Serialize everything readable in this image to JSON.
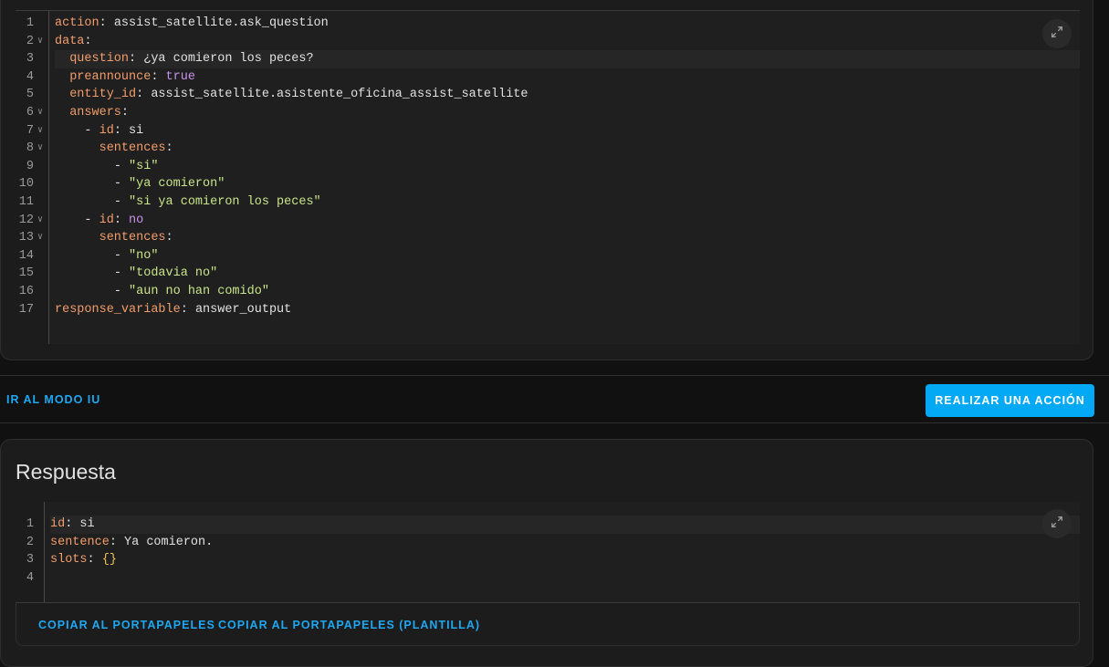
{
  "yaml_editor": {
    "lines": [
      {
        "n": "1",
        "fold": false,
        "indent": 0,
        "parts": [
          [
            "k",
            "action"
          ],
          [
            "p",
            ": "
          ],
          [
            "v",
            "assist_satellite.ask_question"
          ]
        ]
      },
      {
        "n": "2",
        "fold": true,
        "indent": 0,
        "parts": [
          [
            "k",
            "data"
          ],
          [
            "p",
            ":"
          ]
        ]
      },
      {
        "n": "3",
        "fold": false,
        "indent": 2,
        "active": true,
        "parts": [
          [
            "k",
            "question"
          ],
          [
            "p",
            ": "
          ],
          [
            "v",
            "¿ya comieron los peces?"
          ]
        ]
      },
      {
        "n": "4",
        "fold": false,
        "indent": 2,
        "parts": [
          [
            "k",
            "preannounce"
          ],
          [
            "p",
            ": "
          ],
          [
            "b",
            "true"
          ]
        ]
      },
      {
        "n": "5",
        "fold": false,
        "indent": 2,
        "parts": [
          [
            "k",
            "entity_id"
          ],
          [
            "p",
            ": "
          ],
          [
            "v",
            "assist_satellite.asistente_oficina_assist_satellite"
          ]
        ]
      },
      {
        "n": "6",
        "fold": true,
        "indent": 2,
        "parts": [
          [
            "k",
            "answers"
          ],
          [
            "p",
            ":"
          ]
        ]
      },
      {
        "n": "7",
        "fold": true,
        "indent": 4,
        "parts": [
          [
            "p",
            "- "
          ],
          [
            "k",
            "id"
          ],
          [
            "p",
            ": "
          ],
          [
            "v",
            "si"
          ]
        ]
      },
      {
        "n": "8",
        "fold": true,
        "indent": 6,
        "parts": [
          [
            "k",
            "sentences"
          ],
          [
            "p",
            ":"
          ]
        ]
      },
      {
        "n": "9",
        "fold": false,
        "indent": 8,
        "parts": [
          [
            "p",
            "- "
          ],
          [
            "s",
            "\"si\""
          ]
        ]
      },
      {
        "n": "10",
        "fold": false,
        "indent": 8,
        "parts": [
          [
            "p",
            "- "
          ],
          [
            "s",
            "\"ya comieron\""
          ]
        ]
      },
      {
        "n": "11",
        "fold": false,
        "indent": 8,
        "parts": [
          [
            "p",
            "- "
          ],
          [
            "s",
            "\"si ya comieron los peces\""
          ]
        ]
      },
      {
        "n": "12",
        "fold": true,
        "indent": 4,
        "parts": [
          [
            "p",
            "- "
          ],
          [
            "k",
            "id"
          ],
          [
            "p",
            ": "
          ],
          [
            "b",
            "no"
          ]
        ]
      },
      {
        "n": "13",
        "fold": true,
        "indent": 6,
        "parts": [
          [
            "k",
            "sentences"
          ],
          [
            "p",
            ":"
          ]
        ]
      },
      {
        "n": "14",
        "fold": false,
        "indent": 8,
        "parts": [
          [
            "p",
            "- "
          ],
          [
            "s",
            "\"no\""
          ]
        ]
      },
      {
        "n": "15",
        "fold": false,
        "indent": 8,
        "parts": [
          [
            "p",
            "- "
          ],
          [
            "s",
            "\"todavia no\""
          ]
        ]
      },
      {
        "n": "16",
        "fold": false,
        "indent": 8,
        "parts": [
          [
            "p",
            "- "
          ],
          [
            "s",
            "\"aun no han comido\""
          ]
        ]
      },
      {
        "n": "17",
        "fold": false,
        "indent": 0,
        "parts": [
          [
            "k",
            "response_variable"
          ],
          [
            "p",
            ": "
          ],
          [
            "v",
            "answer_output"
          ]
        ]
      }
    ]
  },
  "actions_bar": {
    "ui_mode_label": "IR AL MODO IU",
    "perform_action_label": "REALIZAR UNA ACCIÓN"
  },
  "response": {
    "title": "Respuesta",
    "lines": [
      {
        "n": "1",
        "fold": false,
        "indent": 0,
        "active": true,
        "parts": [
          [
            "k",
            "id"
          ],
          [
            "p",
            ": "
          ],
          [
            "v",
            "si"
          ]
        ]
      },
      {
        "n": "2",
        "fold": false,
        "indent": 0,
        "parts": [
          [
            "k",
            "sentence"
          ],
          [
            "p",
            ": "
          ],
          [
            "v",
            "Ya comieron."
          ]
        ]
      },
      {
        "n": "3",
        "fold": false,
        "indent": 0,
        "parts": [
          [
            "k",
            "slots"
          ],
          [
            "p",
            ": "
          ],
          [
            "br",
            "{}"
          ]
        ]
      },
      {
        "n": "4",
        "fold": false,
        "indent": 0,
        "parts": []
      }
    ],
    "copy_label": "COPIAR AL PORTAPAPELES",
    "copy_template_label": "COPIAR AL PORTAPAPELES (PLANTILLA)"
  },
  "icons": {
    "expand": "fullscreen-icon",
    "fold": "chevron-down-icon"
  },
  "colors": {
    "accent": "#03a9f4",
    "link": "#1ea7f3",
    "yaml_key": "#f29d6b",
    "yaml_string": "#c9e58a",
    "yaml_bool": "#c792ea"
  }
}
